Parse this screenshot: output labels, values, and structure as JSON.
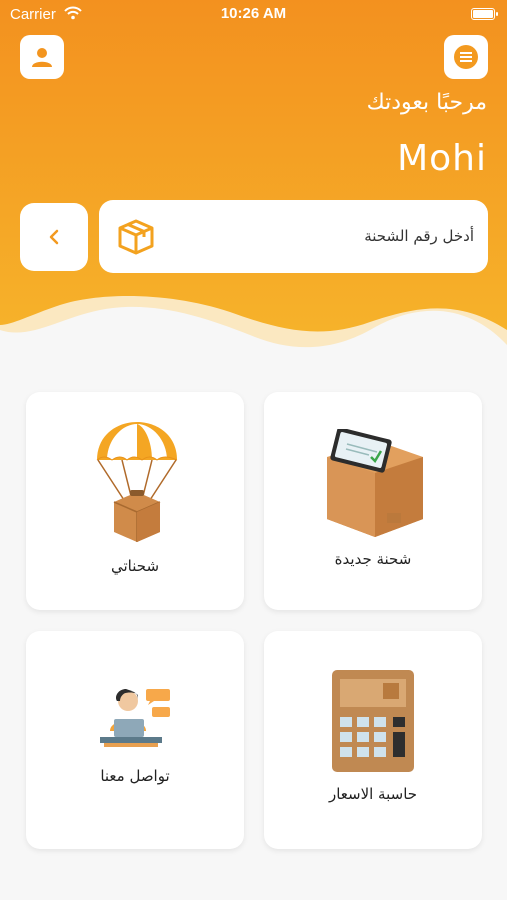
{
  "status_bar": {
    "carrier": "Carrier",
    "time": "10:26 AM"
  },
  "header": {
    "welcome": "مرحبًا بعودتك",
    "username": "Mohi"
  },
  "tracking": {
    "placeholder": "أدخل رقم الشحنة"
  },
  "icons": {
    "profile": "person-icon",
    "menu": "hamburger-menu-icon",
    "back": "chevron-left-icon",
    "box": "package-icon",
    "wifi": "wifi-icon",
    "battery": "battery-icon"
  },
  "cards": [
    {
      "id": "new-shipment",
      "label": "شحنة جديدة",
      "icon": "box-with-tablet-icon"
    },
    {
      "id": "my-shipments",
      "label": "شحناتي",
      "icon": "parachute-package-icon"
    },
    {
      "id": "price-calculator",
      "label": "حاسبة الاسعار",
      "icon": "calculator-icon"
    },
    {
      "id": "contact-us",
      "label": "تواصل معنا",
      "icon": "support-agent-icon"
    }
  ],
  "colors": {
    "accent": "#f4a21f",
    "accent_dark": "#f08a1c",
    "icon_bg": "#ffffff",
    "text": "#222222"
  }
}
